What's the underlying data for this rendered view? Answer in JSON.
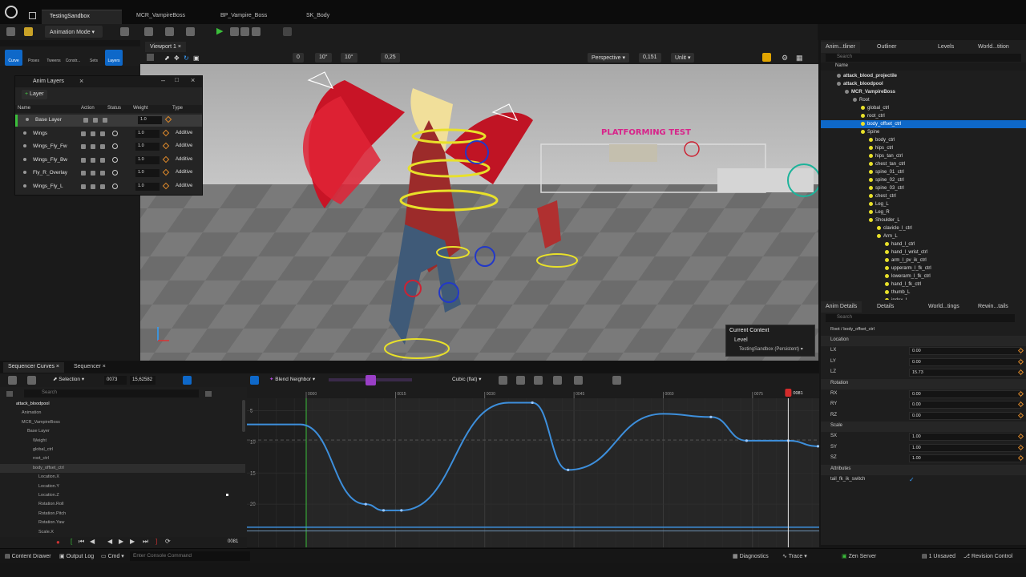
{
  "app": {
    "logo": "unreal-logo"
  },
  "tabs": [
    {
      "label": "TestingSandbox",
      "active": true
    },
    {
      "label": "MCR_VampireBoss",
      "active": false
    },
    {
      "label": "BP_Vampire_Boss",
      "active": false
    },
    {
      "label": "SK_Body",
      "active": false
    }
  ],
  "toolbar": {
    "mode": "Animation Mode"
  },
  "modes": [
    {
      "label": "Curve",
      "selected": true
    },
    {
      "label": "Poses",
      "selected": false
    },
    {
      "label": "Tweens",
      "selected": false
    },
    {
      "label": "Constr...",
      "selected": false
    },
    {
      "label": "Sets",
      "selected": false
    },
    {
      "label": "Layers",
      "selected": true
    }
  ],
  "anim_layers": {
    "title": "Anim Layers",
    "add_label": "Layer",
    "columns": [
      "Name",
      "Action",
      "Status",
      "Weight",
      "Type"
    ],
    "rows": [
      {
        "name": "Base Layer",
        "weight": "1.0",
        "type": ""
      },
      {
        "name": "Wings",
        "weight": "1.0",
        "type": "Additive"
      },
      {
        "name": "Wings_Fly_Fw",
        "weight": "1.0",
        "type": "Additive"
      },
      {
        "name": "Wings_Fly_Bw",
        "weight": "1.0",
        "type": "Additive"
      },
      {
        "name": "Fly_R_Overlay",
        "weight": "1.0",
        "type": "Additive"
      },
      {
        "name": "Wings_Fly_L",
        "weight": "1.0",
        "type": "Additive"
      }
    ]
  },
  "viewport": {
    "tab": "Viewport 1",
    "perspective": "Perspective",
    "unlit": "Unlit",
    "numbers": [
      "0",
      "10°",
      "10°",
      "0,25"
    ],
    "fov_value": "0,151",
    "scene_text": "PLATFORMING TEST",
    "context": {
      "title": "Current Context",
      "level_label": "Level",
      "level_value": "TestingSandbox (Persistent)"
    }
  },
  "outliner": {
    "tabs": [
      "Anim...tliner",
      "Outliner",
      "Levels",
      "World...tition"
    ],
    "search_placeholder": "Search",
    "column": "Name",
    "items": [
      {
        "label": "attack_blood_projectile",
        "depth": 1,
        "bold": true
      },
      {
        "label": "attack_bloodpool",
        "depth": 1,
        "bold": true
      },
      {
        "label": "MCR_VampireBoss",
        "depth": 2,
        "bold": true
      },
      {
        "label": "Root",
        "depth": 3
      },
      {
        "label": "global_ctrl",
        "depth": 4
      },
      {
        "label": "root_ctrl",
        "depth": 4
      },
      {
        "label": "body_offset_ctrl",
        "depth": 4,
        "selected": true
      },
      {
        "label": "Spine",
        "depth": 4
      },
      {
        "label": "body_ctrl",
        "depth": 5
      },
      {
        "label": "hips_ctrl",
        "depth": 5
      },
      {
        "label": "hips_tan_ctrl",
        "depth": 5
      },
      {
        "label": "chest_tan_ctrl",
        "depth": 5
      },
      {
        "label": "spine_01_ctrl",
        "depth": 5
      },
      {
        "label": "spine_02_ctrl",
        "depth": 5
      },
      {
        "label": "spine_03_ctrl",
        "depth": 5
      },
      {
        "label": "chest_ctrl",
        "depth": 5
      },
      {
        "label": "Leg_L",
        "depth": 5
      },
      {
        "label": "Leg_R",
        "depth": 5
      },
      {
        "label": "Shoulder_L",
        "depth": 5
      },
      {
        "label": "clavicle_l_ctrl",
        "depth": 6
      },
      {
        "label": "Arm_L",
        "depth": 6
      },
      {
        "label": "hand_l_ctrl",
        "depth": 7
      },
      {
        "label": "hand_l_wrist_ctrl",
        "depth": 7
      },
      {
        "label": "arm_l_pv_ik_ctrl",
        "depth": 7
      },
      {
        "label": "upperarm_l_fk_ctrl",
        "depth": 7
      },
      {
        "label": "lowerarm_l_fk_ctrl",
        "depth": 7
      },
      {
        "label": "hand_l_fk_ctrl",
        "depth": 7
      },
      {
        "label": "thumb_L",
        "depth": 7
      },
      {
        "label": "index_L",
        "depth": 7
      }
    ]
  },
  "details": {
    "tabs": [
      "Anim Details",
      "Details",
      "World...tings",
      "Rewin...tails"
    ],
    "search_placeholder": "Search",
    "path": "Root / body_offset_ctrl",
    "sections": [
      {
        "title": "Location",
        "fields": [
          {
            "label": "LX",
            "value": "0.00"
          },
          {
            "label": "LY",
            "value": "0.00"
          },
          {
            "label": "LZ",
            "value": "15.73"
          }
        ]
      },
      {
        "title": "Rotation",
        "fields": [
          {
            "label": "RX",
            "value": "0.00"
          },
          {
            "label": "RY",
            "value": "0.00"
          },
          {
            "label": "RZ",
            "value": "0.00"
          }
        ]
      },
      {
        "title": "Scale",
        "fields": [
          {
            "label": "SX",
            "value": "1.00"
          },
          {
            "label": "SY",
            "value": "1.00"
          },
          {
            "label": "SZ",
            "value": "1.00"
          }
        ]
      }
    ],
    "attributes_title": "Attributes",
    "attribute": {
      "label": "tail_fk_ik_switch",
      "checked": true
    }
  },
  "sequencer": {
    "tabs": [
      "Sequencer Curves",
      "Sequencer"
    ],
    "selection_label": "Selection",
    "frame_value": "0073",
    "value_field": "15,62582",
    "blend_label": "Blend Neighbor",
    "interp_label": "Cubic (flat)",
    "search_placeholder": "Search",
    "tree": [
      {
        "label": "attack_bloodpool",
        "depth": 0,
        "bold": true
      },
      {
        "label": "Animation",
        "depth": 1
      },
      {
        "label": "MCR_VampireBoss",
        "depth": 1
      },
      {
        "label": "Base Layer",
        "depth": 2
      },
      {
        "label": "Weight",
        "depth": 3
      },
      {
        "label": "global_ctrl",
        "depth": 3
      },
      {
        "label": "root_ctrl",
        "depth": 3
      },
      {
        "label": "body_offset_ctrl",
        "depth": 3,
        "selected": true
      },
      {
        "label": "Location.X",
        "depth": 4
      },
      {
        "label": "Location.Y",
        "depth": 4
      },
      {
        "label": "Location.Z",
        "depth": 4
      },
      {
        "label": "Rotation.Roll",
        "depth": 4
      },
      {
        "label": "Rotation.Pitch",
        "depth": 4
      },
      {
        "label": "Rotation.Yaw",
        "depth": 4
      },
      {
        "label": "Scale.X",
        "depth": 4
      }
    ],
    "current_frame": "0081",
    "playhead_label": "0081",
    "ruler_ticks": [
      "-0015",
      "0000",
      "0015",
      "0030",
      "0045",
      "0060",
      "0075",
      "0090",
      "0105",
      "0120",
      "0135"
    ],
    "y_ticks": [
      "20",
      "15",
      "10",
      "5"
    ]
  },
  "chart_data": {
    "type": "line",
    "title": "",
    "xlabel": "",
    "ylabel": "",
    "xlim": [
      -20,
      140
    ],
    "ylim": [
      0,
      22
    ],
    "x_ticks": [
      -15,
      0,
      15,
      30,
      45,
      60,
      75,
      90,
      105,
      120,
      135
    ],
    "y_ticks": [
      5,
      10,
      15,
      20
    ],
    "series": [
      {
        "x": [
          -20,
          -1,
          10,
          13,
          16,
          34,
          38,
          44,
          60,
          68,
          74,
          81,
          86,
          92,
          140
        ],
        "y": [
          17.8,
          17.8,
          5.0,
          4.0,
          4.0,
          21.3,
          21.3,
          10.5,
          19.5,
          19.0,
          15.2,
          15.2,
          14.3,
          17.8,
          17.8
        ]
      }
    ],
    "keys_x": [
      10,
      13,
      16,
      38,
      44,
      68,
      74,
      81,
      86,
      92
    ]
  },
  "statusbar": {
    "content_drawer": "Content Drawer",
    "output_log": "Output Log",
    "cmd": "Cmd",
    "console_placeholder": "Enter Console Command",
    "diagnostics": "Diagnostics",
    "trace": "Trace",
    "zen": "Zen Server",
    "unsaved": "1 Unsaved",
    "revision": "Revision Control"
  },
  "colors": {
    "accent": "#0e68c9",
    "curve": "#3d8fdc",
    "playhead": "#d32b2b",
    "rig_yellow": "#e8e02a",
    "wing_red": "#d8192b"
  }
}
